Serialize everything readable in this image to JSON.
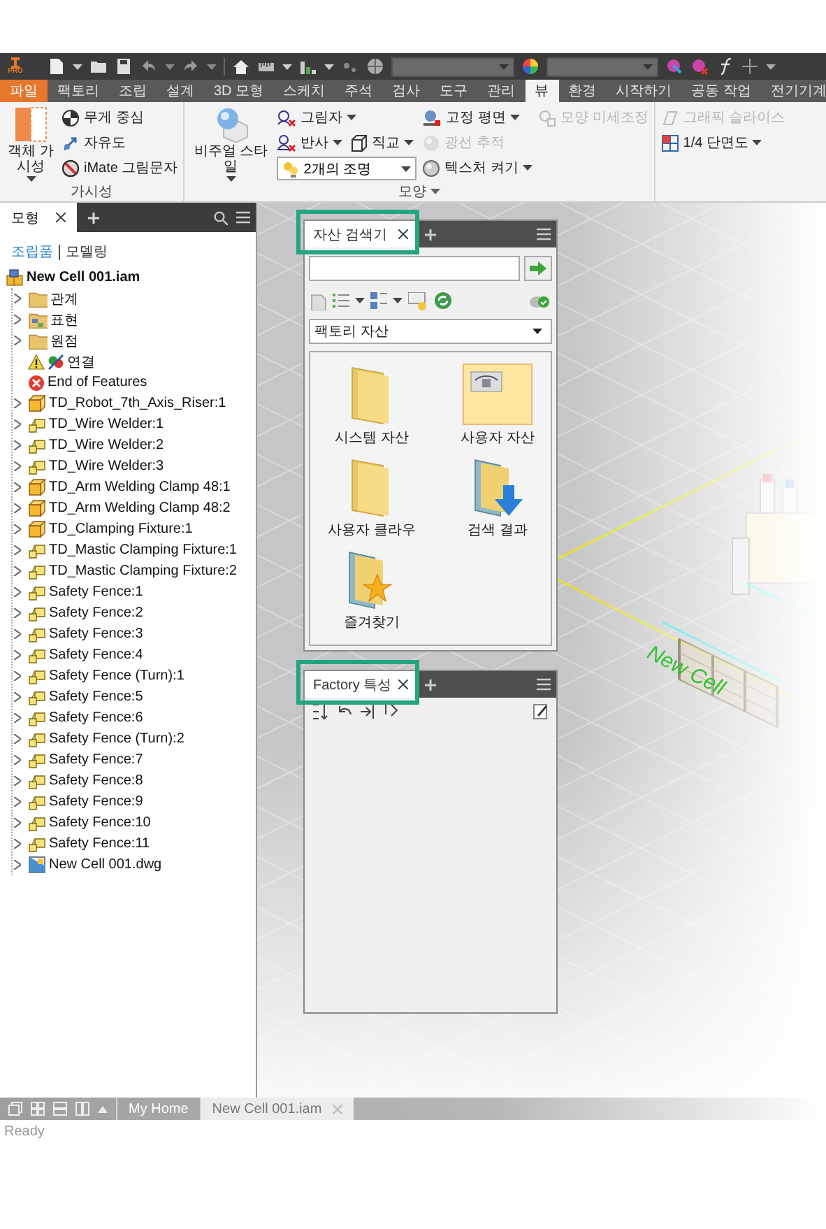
{
  "app": {
    "badge": "PRO"
  },
  "ribbon_tabs": [
    {
      "label": "파일",
      "kind": "file",
      "selected": false
    },
    {
      "label": "팩토리",
      "kind": "tab",
      "selected": false
    },
    {
      "label": "조립",
      "kind": "tab",
      "selected": false
    },
    {
      "label": "설계",
      "kind": "tab",
      "selected": false
    },
    {
      "label": "3D 모형",
      "kind": "tab",
      "selected": false
    },
    {
      "label": "스케치",
      "kind": "tab",
      "selected": false
    },
    {
      "label": "주석",
      "kind": "tab",
      "selected": false
    },
    {
      "label": "검사",
      "kind": "tab",
      "selected": false
    },
    {
      "label": "도구",
      "kind": "tab",
      "selected": false
    },
    {
      "label": "관리",
      "kind": "tab",
      "selected": false
    },
    {
      "label": "뷰",
      "kind": "tab",
      "selected": true
    },
    {
      "label": "환경",
      "kind": "tab",
      "selected": false
    },
    {
      "label": "시작하기",
      "kind": "tab",
      "selected": false
    },
    {
      "label": "공동 작업",
      "kind": "tab",
      "selected": false
    },
    {
      "label": "전기기계",
      "kind": "tab",
      "selected": false
    }
  ],
  "ribbon_groups": [
    {
      "title": "가시성",
      "title_menu": false,
      "columns": [
        [
          [
            {
              "kind": "large",
              "label": "객체 가시성",
              "menu": true,
              "disabled": false
            }
          ]
        ],
        [
          [
            {
              "kind": "small",
              "label": "무게 중심",
              "menu": false,
              "disabled": false
            }
          ],
          [
            {
              "kind": "small",
              "label": "자유도",
              "menu": false,
              "disabled": false
            }
          ],
          [
            {
              "kind": "small",
              "label": "iMate 그림문자",
              "menu": false,
              "disabled": false
            }
          ]
        ]
      ]
    },
    {
      "title": "모양",
      "title_menu": true,
      "columns": [
        [
          [
            {
              "kind": "large",
              "label": "비주얼 스타일",
              "menu": true,
              "disabled": false
            }
          ]
        ],
        [
          [
            {
              "kind": "small",
              "label": "그림자",
              "menu": true,
              "disabled": false
            }
          ],
          [
            {
              "kind": "small",
              "label": "반사",
              "menu": true,
              "disabled": false
            },
            {
              "kind": "small",
              "label": "직교",
              "menu": true,
              "disabled": false
            }
          ],
          [
            {
              "kind": "combo",
              "value": "2개의 조명"
            }
          ]
        ],
        [
          [
            {
              "kind": "small",
              "label": "고정 평면",
              "menu": true,
              "disabled": false
            }
          ],
          [
            {
              "kind": "small",
              "label": "광선 추적",
              "menu": false,
              "disabled": true
            }
          ],
          [
            {
              "kind": "small",
              "label": "텍스처 켜기",
              "menu": true,
              "disabled": false
            }
          ]
        ],
        [
          [
            {
              "kind": "small",
              "label": "모양 미세조정",
              "menu": false,
              "disabled": true
            }
          ]
        ]
      ]
    },
    {
      "columns": [
        [
          [
            {
              "kind": "small",
              "label": "그래픽 슬라이스",
              "menu": false,
              "disabled": true
            }
          ],
          [
            {
              "kind": "small",
              "label": "1/4 단면도",
              "menu": true,
              "disabled": false
            }
          ]
        ]
      ]
    }
  ],
  "model_browser": {
    "tab": "모형",
    "modes": [
      {
        "label": "조립품",
        "selected": true
      },
      {
        "label": "모델링",
        "selected": false
      }
    ],
    "tree": {
      "label": "New Cell 001.iam",
      "kind": "assembly",
      "children": [
        {
          "label": "관계",
          "kind": "folder",
          "expandable": true
        },
        {
          "label": "표현",
          "kind": "views",
          "expandable": true
        },
        {
          "label": "원점",
          "kind": "folder",
          "expandable": true
        },
        {
          "label": "연결",
          "kind": "joint",
          "expandable": false
        },
        {
          "label": "End of Features",
          "kind": "end",
          "expandable": false
        },
        {
          "label": "TD_Robot_7th_Axis_Riser:1",
          "kind": "part",
          "expandable": true
        },
        {
          "label": "TD_Wire Welder:1",
          "kind": "asset",
          "expandable": true
        },
        {
          "label": "TD_Wire Welder:2",
          "kind": "asset",
          "expandable": true
        },
        {
          "label": "TD_Wire Welder:3",
          "kind": "asset",
          "expandable": true
        },
        {
          "label": "TD_Arm Welding Clamp 48:1",
          "kind": "part",
          "expandable": true
        },
        {
          "label": "TD_Arm Welding Clamp 48:2",
          "kind": "part",
          "expandable": true
        },
        {
          "label": "TD_Clamping Fixture:1",
          "kind": "part",
          "expandable": true
        },
        {
          "label": "TD_Mastic Clamping Fixture:1",
          "kind": "asset",
          "expandable": true
        },
        {
          "label": "TD_Mastic Clamping Fixture:2",
          "kind": "asset",
          "expandable": true
        },
        {
          "label": "Safety Fence:1",
          "kind": "asset",
          "expandable": true
        },
        {
          "label": "Safety Fence:2",
          "kind": "asset",
          "expandable": true
        },
        {
          "label": "Safety Fence:3",
          "kind": "asset",
          "expandable": true
        },
        {
          "label": "Safety Fence:4",
          "kind": "asset",
          "expandable": true
        },
        {
          "label": "Safety Fence (Turn):1",
          "kind": "asset",
          "expandable": true
        },
        {
          "label": "Safety Fence:5",
          "kind": "asset",
          "expandable": true
        },
        {
          "label": "Safety Fence:6",
          "kind": "asset",
          "expandable": true
        },
        {
          "label": "Safety Fence (Turn):2",
          "kind": "asset",
          "expandable": true
        },
        {
          "label": "Safety Fence:7",
          "kind": "asset",
          "expandable": true
        },
        {
          "label": "Safety Fence:8",
          "kind": "asset",
          "expandable": true
        },
        {
          "label": "Safety Fence:9",
          "kind": "asset",
          "expandable": true
        },
        {
          "label": "Safety Fence:10",
          "kind": "asset",
          "expandable": true
        },
        {
          "label": "Safety Fence:11",
          "kind": "asset",
          "expandable": true
        },
        {
          "label": "New Cell 001.dwg",
          "kind": "dwg",
          "expandable": true
        }
      ]
    }
  },
  "asset_browser": {
    "title": "자산 검색기",
    "library": "팩토리 자산",
    "items": [
      {
        "label": "시스템 자산",
        "kind": "folder",
        "selected": false
      },
      {
        "label": "사용자 자산",
        "kind": "custom",
        "selected": true
      },
      {
        "label": "사용자 클라우",
        "kind": "folder",
        "selected": false
      },
      {
        "label": "검색 결과",
        "kind": "results",
        "selected": false
      },
      {
        "label": "즐겨찾기",
        "kind": "favorites",
        "selected": false
      }
    ]
  },
  "properties_panel": {
    "title": "Factory 특성"
  },
  "viewport": {
    "cell_label": "New Cell"
  },
  "documents": {
    "tabs": [
      {
        "label": "My Home",
        "selected": false,
        "closable": false
      },
      {
        "label": "New Cell 001.iam",
        "selected": true,
        "closable": true
      }
    ]
  },
  "status_bar": "Ready"
}
